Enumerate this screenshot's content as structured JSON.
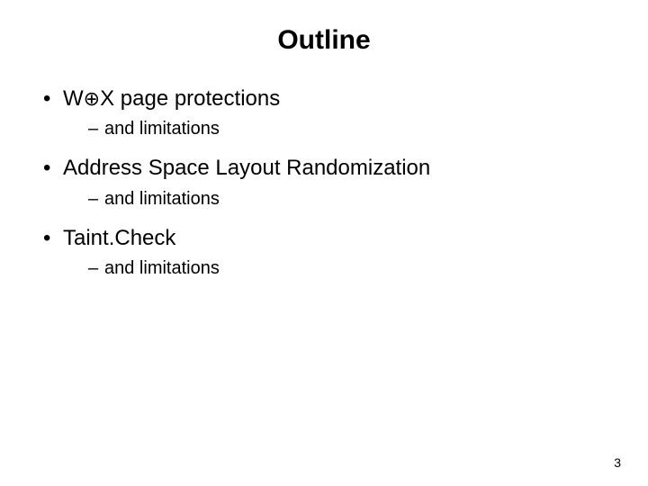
{
  "slide": {
    "title": "Outline",
    "bullets": [
      {
        "text_before": "W",
        "symbol": "⊕",
        "text_after": "X page protections",
        "sub": "and limitations"
      },
      {
        "text": "Address Space Layout Randomization",
        "sub": "and limitations"
      },
      {
        "text": "Taint.Check",
        "sub": "and limitations"
      }
    ],
    "page_number": "3"
  }
}
